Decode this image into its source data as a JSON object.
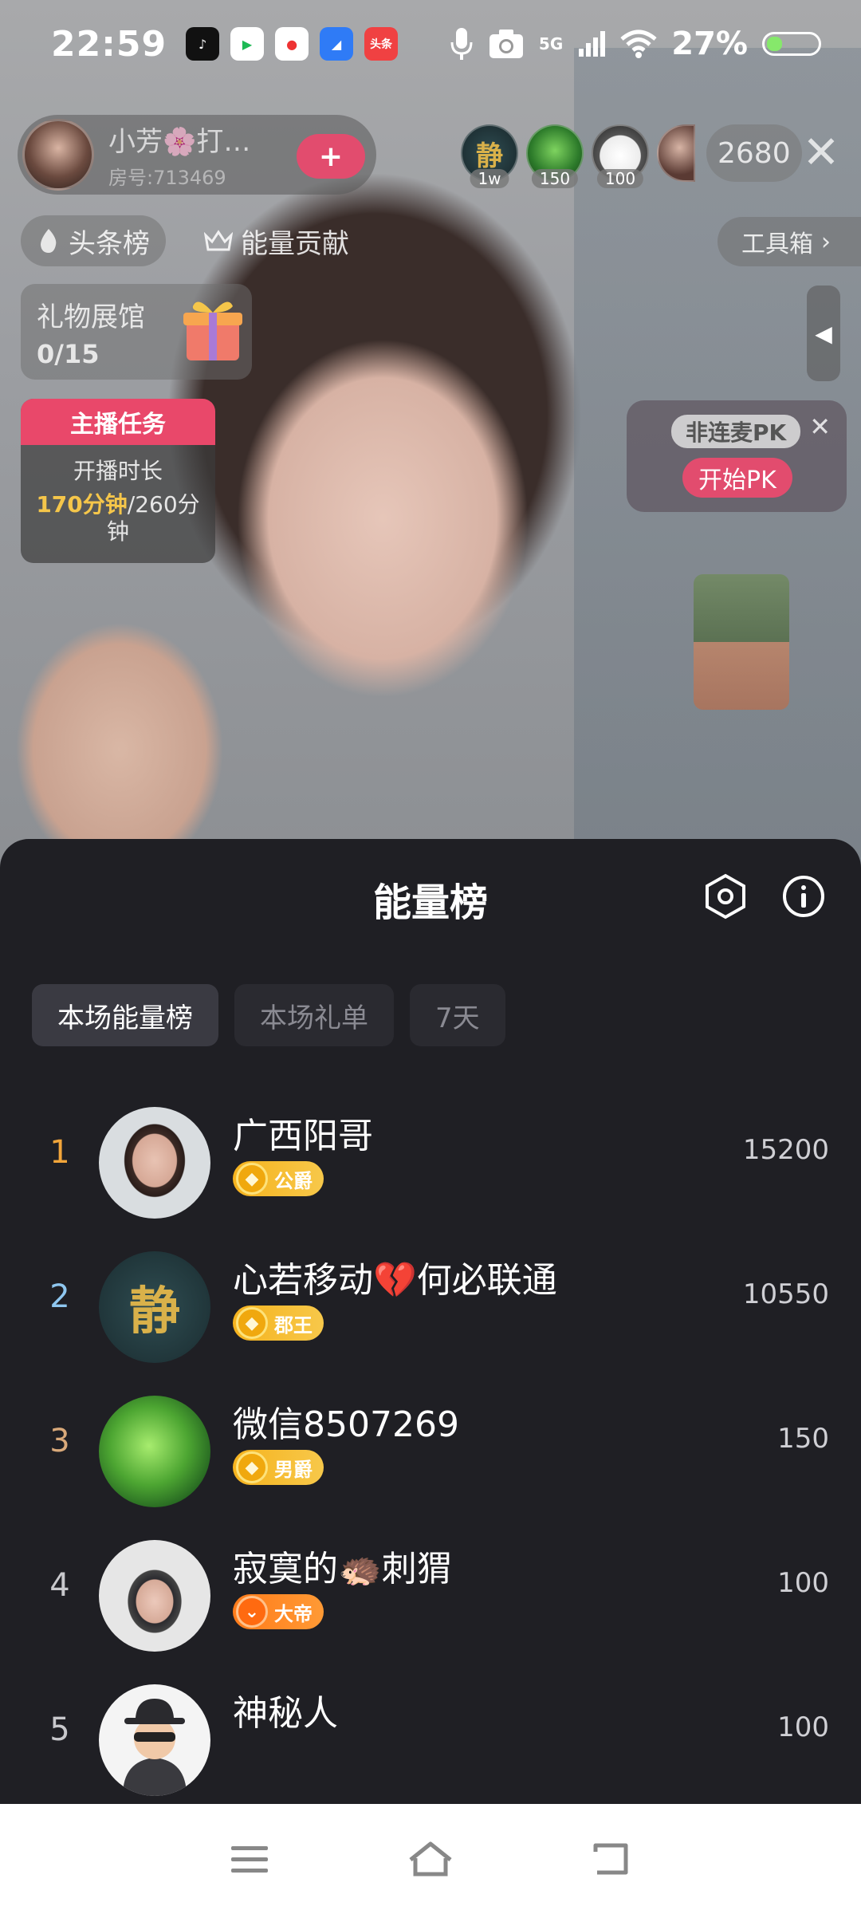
{
  "status_bar": {
    "time": "22:59",
    "battery": "27%",
    "network": "5G",
    "app_icons": [
      "tiktok-icon",
      "video-app-icon",
      "map-app-icon",
      "files-app-icon",
      "toutiao-icon"
    ],
    "toutiao_label": "头条"
  },
  "host": {
    "name": "小芳🌸打…",
    "room": "房号:713469",
    "follow_symbol": "+"
  },
  "viewers": {
    "badges": [
      "1w",
      "150",
      "100",
      ""
    ],
    "count": "2680",
    "avatar_glyph": "静"
  },
  "chips": {
    "headlines": "头条榜",
    "energy": "能量贡献",
    "toolbox": "工具箱"
  },
  "gift_hall": {
    "label": "礼物展馆",
    "count": "0/15"
  },
  "task": {
    "title": "主播任务",
    "line1": "开播时长",
    "progress": "170分钟",
    "total": "/260分",
    "tail": "钟"
  },
  "pk": {
    "title": "非连麦PK",
    "button": "开始PK"
  },
  "sheet": {
    "title": "能量榜",
    "tabs": [
      "本场能量榜",
      "本场礼单",
      "7天"
    ],
    "rows": [
      {
        "rank": "1",
        "name": "广西阳哥",
        "badge": "公爵",
        "score": "15200"
      },
      {
        "rank": "2",
        "name": "心若移动💔何必联通",
        "badge": "郡王",
        "score": "10550"
      },
      {
        "rank": "3",
        "name": "微信8507269",
        "badge": "男爵",
        "score": "150"
      },
      {
        "rank": "4",
        "name": "寂寞的🦔刺猬",
        "badge": "大帝",
        "score": "100"
      },
      {
        "rank": "5",
        "name": "神秘人",
        "badge": "",
        "score": "100"
      }
    ]
  },
  "colors": {
    "rank1": "#f2a53a",
    "rank2": "#8fc7f0",
    "rank3": "#d9a97a",
    "rank_other": "#c8c8cc",
    "accent_pink": "#e24c6e",
    "sheet_bg": "#1f1f24"
  }
}
